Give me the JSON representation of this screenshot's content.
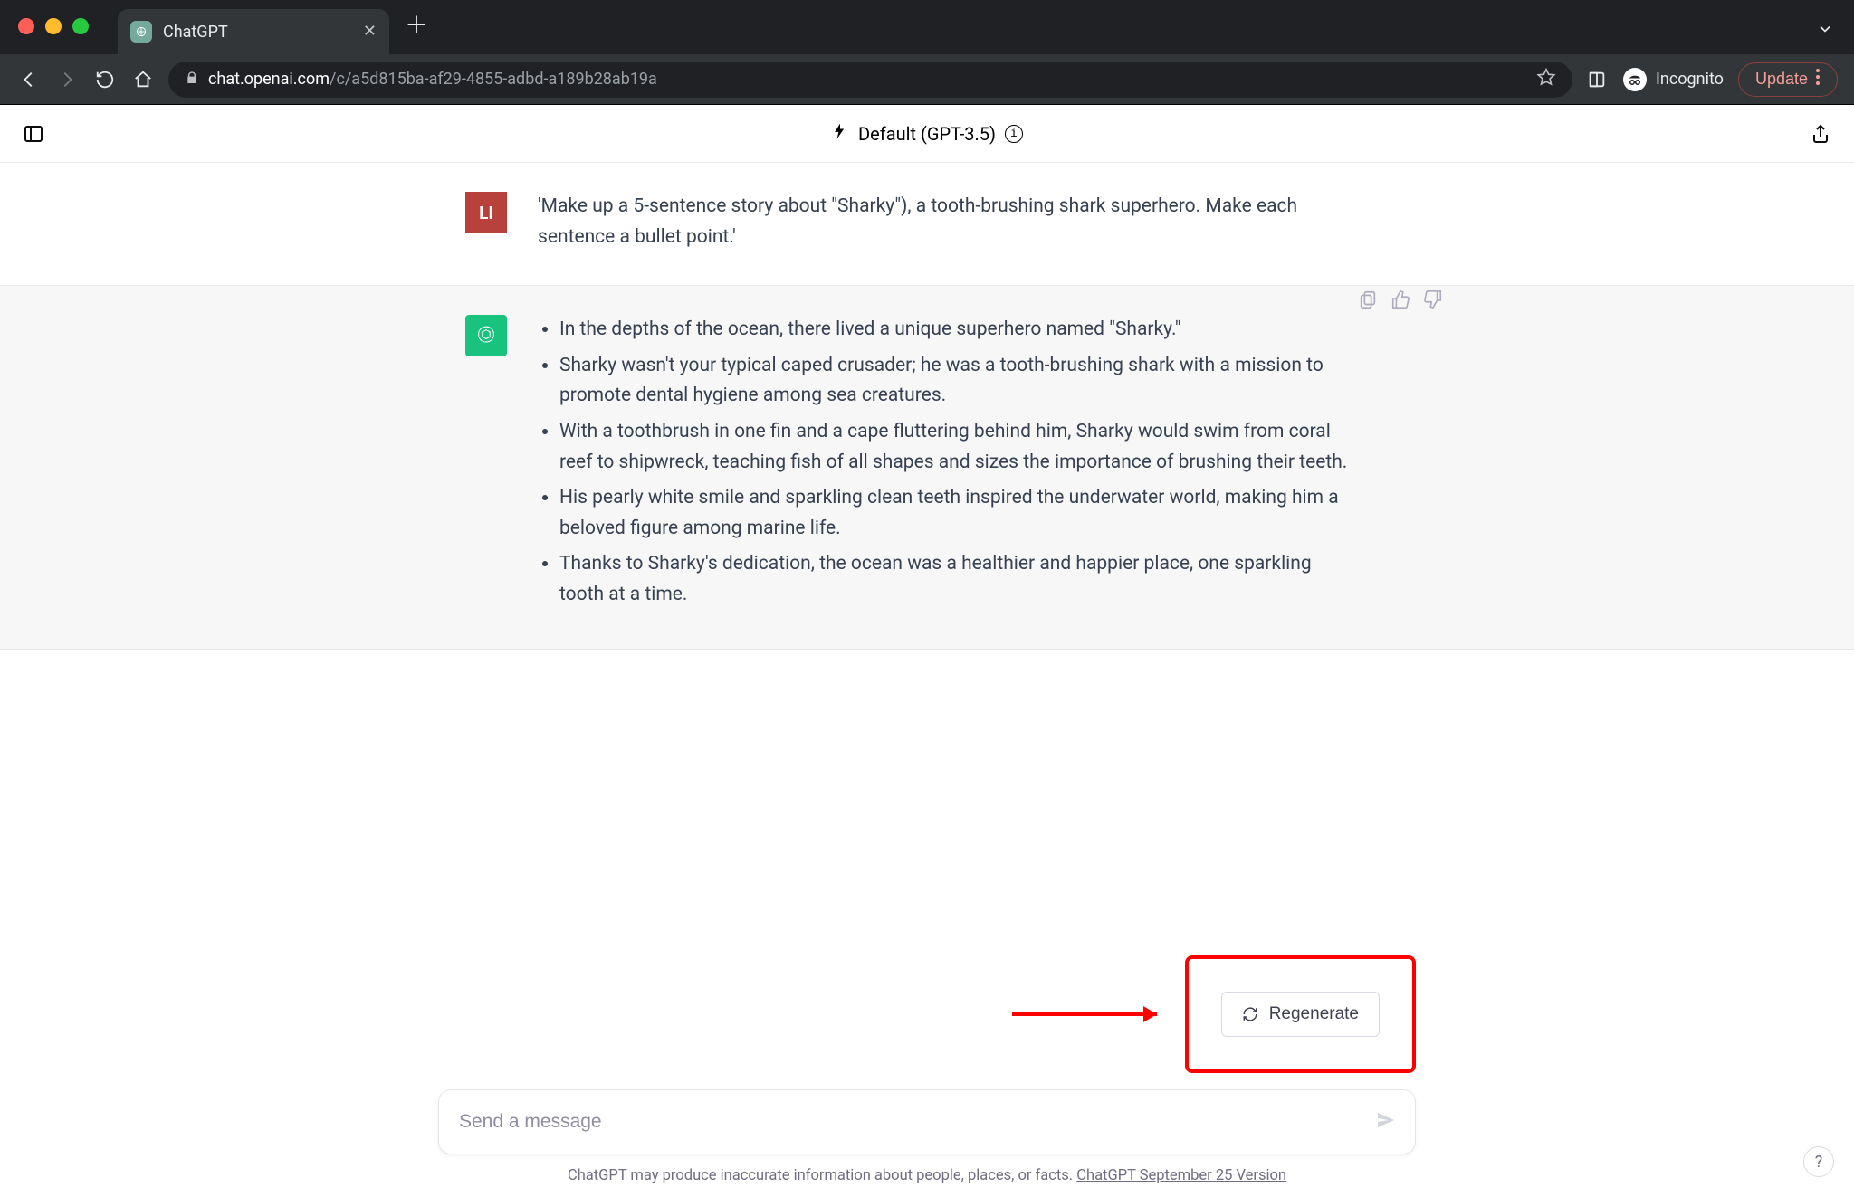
{
  "browser": {
    "window_controls": {
      "close": "close",
      "minimize": "minimize",
      "maximize": "maximize"
    },
    "tab_title": "ChatGPT",
    "url_domain": "chat.openai.com",
    "url_path": "/c/a5d815ba-af29-4855-adbd-a189b28ab19a",
    "incognito_label": "Incognito",
    "update_label": "Update"
  },
  "app": {
    "model_label": "Default (GPT-3.5)",
    "user_avatar_initials": "LI",
    "user_message": "'Make up a 5-sentence story about \"Sharky\"), a tooth-brushing shark superhero. Make each sentence a bullet point.'",
    "assistant_bullets": [
      "In the depths of the ocean, there lived a unique superhero named \"Sharky.\"",
      "Sharky wasn't your typical caped crusader; he was a tooth-brushing shark with a mission to promote dental hygiene among sea creatures.",
      "With a toothbrush in one fin and a cape fluttering behind him, Sharky would swim from coral reef to shipwreck, teaching fish of all shapes and sizes the importance of brushing their teeth.",
      "His pearly white smile and sparkling clean teeth inspired the underwater world, making him a beloved figure among marine life.",
      "Thanks to Sharky's dedication, the ocean was a healthier and happier place, one sparkling tooth at a time."
    ],
    "regenerate_label": "Regenerate",
    "composer_placeholder": "Send a message",
    "footer_prefix": "ChatGPT may produce inaccurate information about people, places, or facts. ",
    "footer_link": "ChatGPT September 25 Version",
    "help_label": "?"
  }
}
